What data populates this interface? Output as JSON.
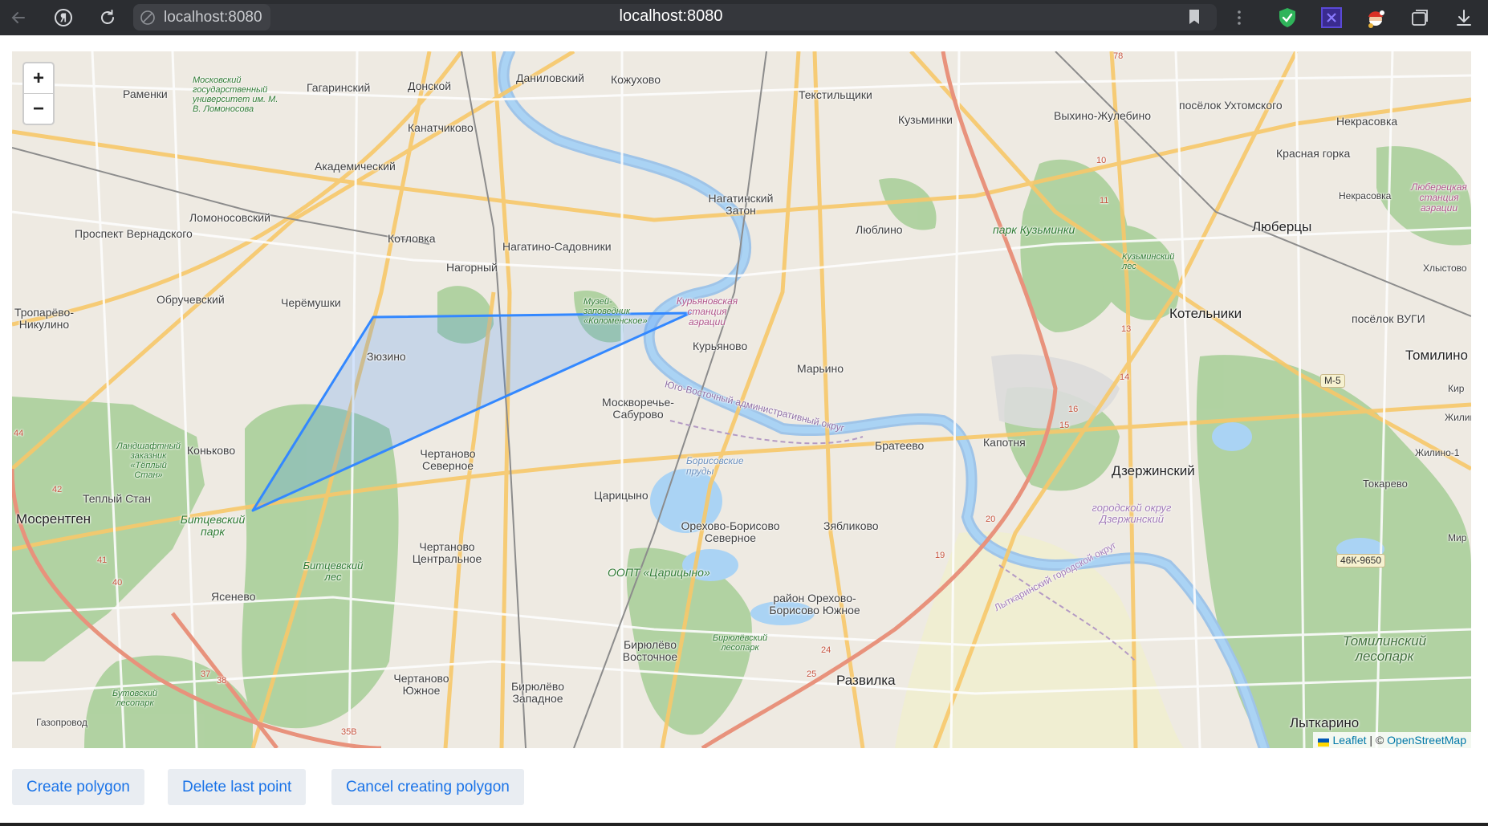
{
  "browser": {
    "site_chip": "localhost:8080",
    "address": "localhost:8080",
    "icons": [
      "back-icon",
      "yandex-icon",
      "reload-icon",
      "site-info-icon",
      "bookmark-icon",
      "menu-dots-icon",
      "shield-extension-icon",
      "extension-x-icon",
      "extension-santa-icon",
      "tabs-icon",
      "download-icon"
    ]
  },
  "map": {
    "zoom_in": "+",
    "zoom_out": "−",
    "attribution": {
      "leaflet": "Leaflet",
      "separator": " | © ",
      "osm": "OpenStreetMap"
    },
    "labels": {
      "l1": "Раменки",
      "l2": "Московский государственный университет им. М. В. Ломоносова",
      "l3": "Гагаринский",
      "l4": "Донской",
      "l5": "Даниловский",
      "l6": "Кожухово",
      "l7": "Текстильщики",
      "l8": "Кузьминки",
      "l9": "Выхино-Жулебино",
      "l10": "посёлок Ухтомского",
      "l11": "Некрасовка",
      "l12": "Красная горка",
      "l13": "Канатчиково",
      "l14": "Академический",
      "l15": "Нагатинский Затон",
      "l16": "Ломоносовский",
      "l17": "Проспект Вернадского",
      "l18": "Котловка",
      "l19": "Нагатино-Садовники",
      "l20": "Люблино",
      "l21": "парк Кузьминки",
      "l22": "Люберцы",
      "l23": "Нагорный",
      "l24": "Обручевский",
      "l25": "Черёмушки",
      "l26": "Тропарёво-Никулино",
      "l27": "Музей-заповедник «Коломенское»",
      "l28": "Курьяновская станция аэрации",
      "l29": "Котельники",
      "l30": "посёлок ВУГИ",
      "l31": "Зюзино",
      "l32": "Курьяново",
      "l33": "Марьино",
      "l34": "Томилино",
      "l35": "Москворечье-Сабурово",
      "l36": "Юго-Восточный административный округ",
      "l37": "Братеево",
      "l38": "Капотня",
      "l39": "Коньково",
      "l40": "Чертаново Северное",
      "l41": "Борисовские пруды",
      "l42": "Дзержинский",
      "l43": "Токарево",
      "l44": "Теплый Стан",
      "l45": "Царицыно",
      "l46": "Мосрентген",
      "l47": "Битцевский парк",
      "l48": "Орехово-Борисово Северное",
      "l49": "Зябликово",
      "l50": "городской округ Дзержинский",
      "l51": "Чертаново Центральное",
      "l52": "ООПТ «Царицыно»",
      "l53": "Битцевский лес",
      "l54": "Ясенево",
      "l55": "район Орехово-Борисово Южное",
      "l56": "Лыткаринский городской округ",
      "l57": "Бирюлёво Восточное",
      "l58": "Бирюлёвский лесопарк",
      "l59": "Томилинский лесопарк",
      "l60": "Развилка",
      "l61": "Чертаново Южное",
      "l62": "Бирюлёво Западное",
      "l63": "Бутовский лесопарк",
      "l64": "Газопровод",
      "l65": "Лыткарино",
      "l66": "Ландшафтный заказник «Тёплый Стан»",
      "l67": "Некрасовка",
      "l68": "Люберецкая станция аэрации",
      "l69": "Кузьминский лес",
      "l70": "Хлыстово",
      "l71": "Жилино-1",
      "l72": "Мир",
      "l73": "Кир",
      "l74": "Жилин"
    },
    "road_badges": [
      "М-5",
      "46К-9650"
    ],
    "km_marks": [
      "10",
      "11",
      "13",
      "14",
      "15",
      "16",
      "19",
      "20",
      "24",
      "25",
      "37",
      "38",
      "40",
      "41",
      "42",
      "44",
      "35В",
      "78"
    ]
  },
  "buttons": {
    "create": "Create polygon",
    "delete_last": "Delete last point",
    "cancel": "Cancel creating polygon"
  }
}
